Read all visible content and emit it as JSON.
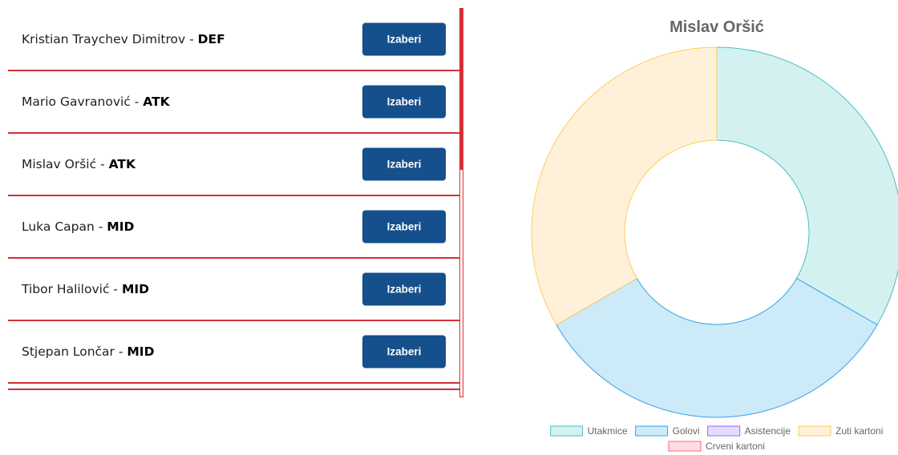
{
  "players": [
    {
      "name": "Kristian Traychev Dimitrov",
      "separator": " - ",
      "position": "DEF",
      "button": "Izaberi"
    },
    {
      "name": "Mario Gavranović",
      "separator": " - ",
      "position": "ATK",
      "button": "Izaberi"
    },
    {
      "name": "Mislav Oršić",
      "separator": " - ",
      "position": "ATK",
      "button": "Izaberi"
    },
    {
      "name": "Luka Capan",
      "separator": " - ",
      "position": "MID",
      "button": "Izaberi"
    },
    {
      "name": "Tibor Halilović",
      "separator": " - ",
      "position": "MID",
      "button": "Izaberi"
    },
    {
      "name": "Stjepan Lončar",
      "separator": " - ",
      "position": "MID",
      "button": "Izaberi"
    }
  ],
  "chart_data": {
    "type": "doughnut",
    "title": "Mislav Oršić",
    "categories": [
      "Utakmice",
      "Golovi",
      "Asistencije",
      "Zuti kartoni",
      "Crveni kartoni"
    ],
    "values": [
      1,
      1,
      0,
      1,
      0
    ],
    "colors": {
      "fill": [
        "#d4f1f1",
        "#cdeaf8",
        "#e5dbfd",
        "#fff1d9",
        "#ffdde4"
      ],
      "border": [
        "#4bc0c0",
        "#36a2eb",
        "#9966ff",
        "#ffcd56",
        "#ff6384"
      ]
    },
    "legend": "bottom"
  }
}
